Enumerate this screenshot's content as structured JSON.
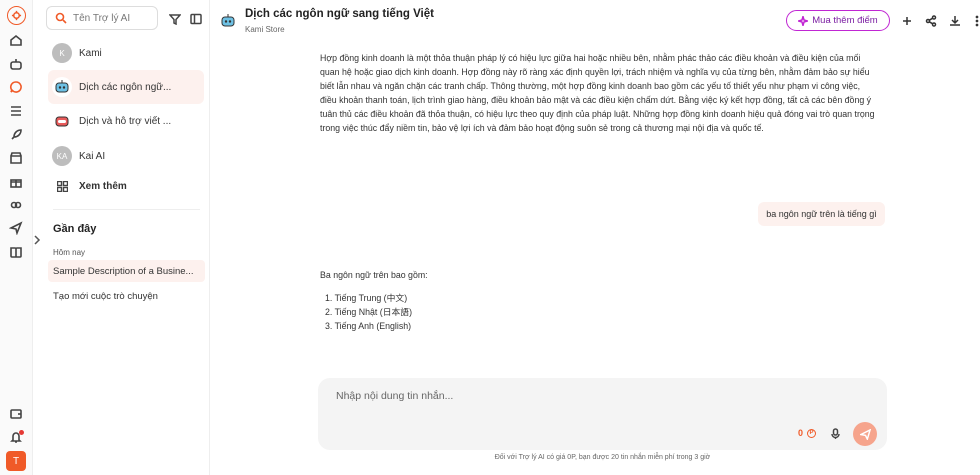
{
  "rail": {
    "user_initial": "T"
  },
  "sidebar": {
    "search_placeholder": "Tên Trợ lý AI",
    "bots": [
      {
        "initials": "K",
        "label": "Kami"
      },
      {
        "label": "Dịch các ngôn ngữ..."
      },
      {
        "label": "Dịch và hỗ trợ viết ..."
      },
      {
        "initials": "KA",
        "label": "Kai AI"
      }
    ],
    "see_more": "Xem thêm",
    "recent_title": "Gần đây",
    "today_label": "Hôm nay",
    "history": [
      "Sample Description of a Busine...",
      "Tạo mới cuộc trò chuyện"
    ]
  },
  "header": {
    "title": "Dịch các ngôn ngữ sang tiếng Việt",
    "subtitle": "Kami Store",
    "buy_points": "Mua thêm điểm"
  },
  "conversation": {
    "ai_paragraph": "Hợp đồng kinh doanh là một thỏa thuận pháp lý có hiệu lực giữa hai hoặc nhiều bên, nhằm phác thảo các điều khoản và điều kiện của mối quan hệ hoặc giao dịch kinh doanh. Hợp đồng này rõ ràng xác định quyền lợi, trách nhiệm và nghĩa vụ của từng bên, nhằm đảm bảo sự hiểu biết lẫn nhau và ngăn chặn các tranh chấp. Thông thường, một hợp đồng kinh doanh bao gồm các yếu tố thiết yếu như phạm vi công việc, điều khoản thanh toán, lịch trình giao hàng, điều khoản bảo mật và các điều kiện chấm dứt. Bằng việc ký kết hợp đồng, tất cả các bên đồng ý tuân thủ các điều khoản đã thỏa thuận, có hiệu lực theo quy định của pháp luật. Những hợp đồng kinh doanh hiệu quả đóng vai trò quan trọng trong việc thúc đẩy niềm tin, bảo vệ lợi ích và đảm bảo hoạt động suôn sẻ trong cả thương mại nội địa và quốc tế.",
    "user_message": "ba ngôn ngữ trên là tiếng gì",
    "answer_intro": "Ba ngôn ngữ trên bao gồm:",
    "answer_list": [
      "1. Tiếng Trung (中文)",
      "2. Tiếng Nhật (日本語)",
      "3. Tiếng Anh (English)"
    ]
  },
  "composer": {
    "placeholder": "Nhập nội dung tin nhắn...",
    "points": "0",
    "coin_symbol": "P",
    "footnote": "Đối với Trợ lý AI có giá 0P, bạn được 20 tin nhắn miễn phí trong 3 giờ"
  }
}
